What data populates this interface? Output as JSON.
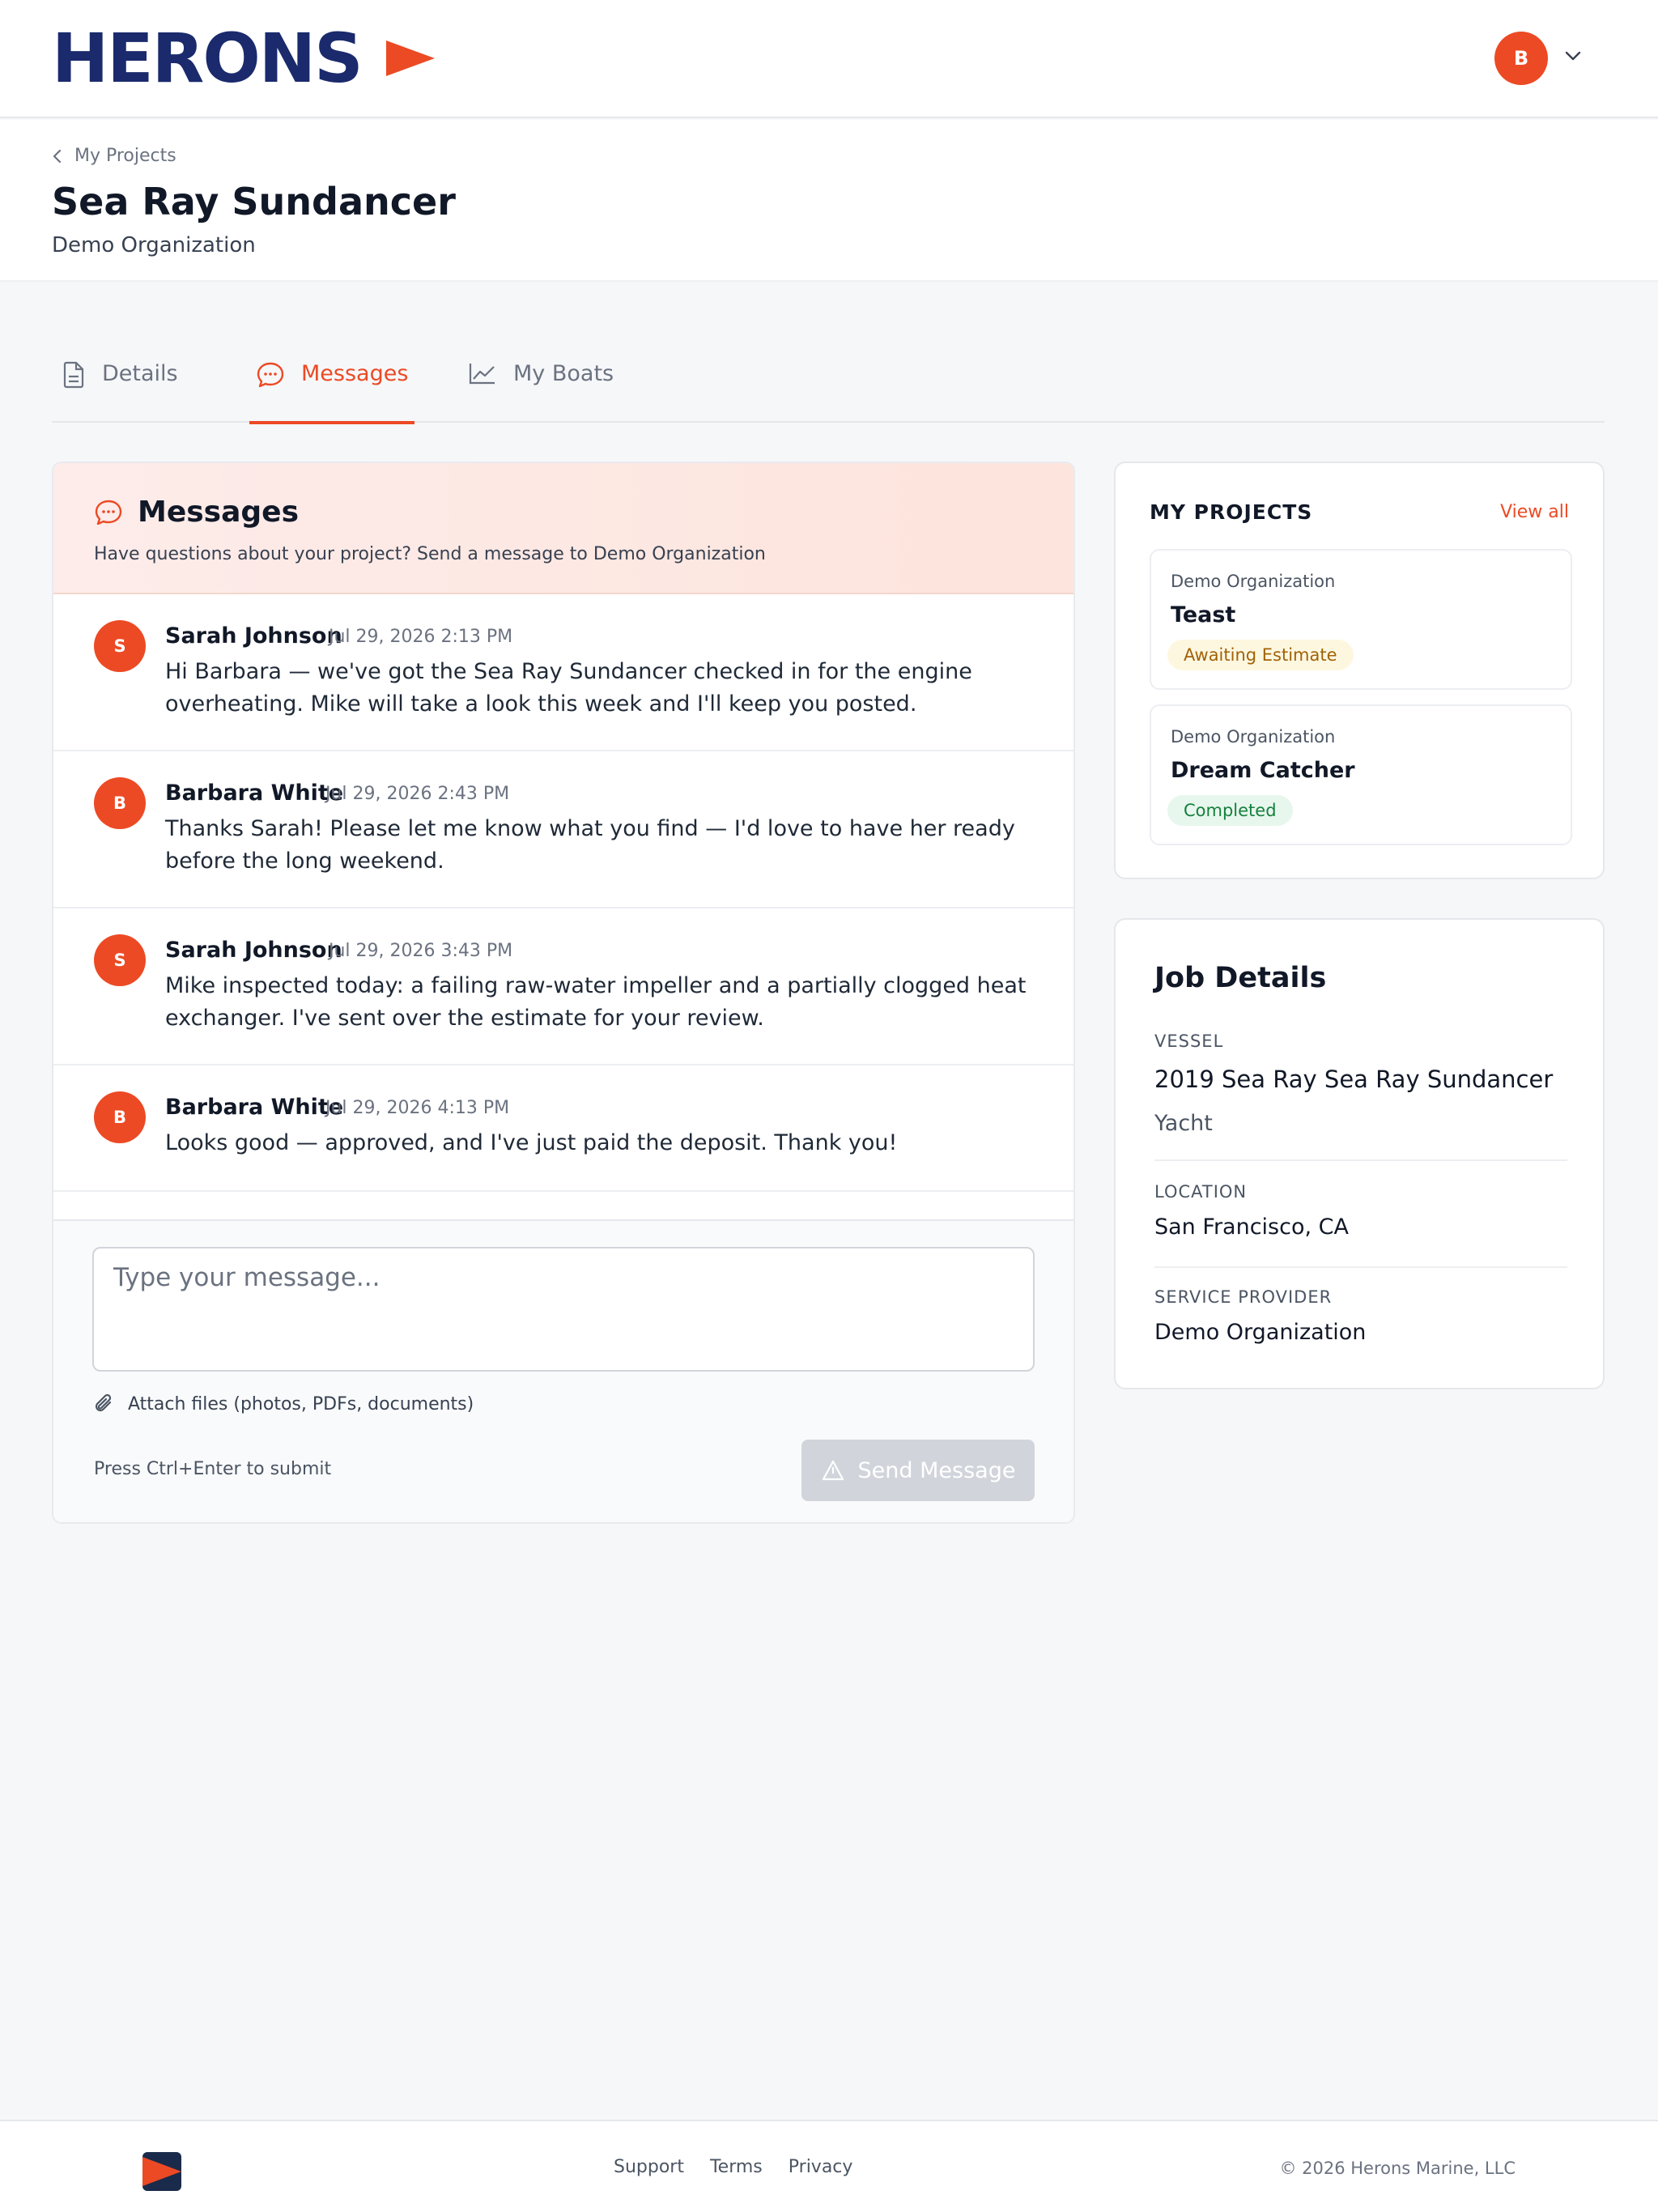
{
  "header": {
    "logo_text": "HERONS",
    "user_initial": "B"
  },
  "breadcrumb": {
    "back_label": "My Projects"
  },
  "page": {
    "title": "Sea Ray Sundancer",
    "subtitle": "Demo Organization"
  },
  "tabs": [
    {
      "label": "Details",
      "icon": "document-icon",
      "active": false
    },
    {
      "label": "Messages",
      "icon": "chat-icon",
      "active": true
    },
    {
      "label": "My Boats",
      "icon": "chart-line-icon",
      "active": false
    }
  ],
  "messages_panel": {
    "title": "Messages",
    "subtitle": "Have questions about your project? Send a message to Demo Organization",
    "items": [
      {
        "initial": "S",
        "author": "Sarah Johnson",
        "time": "Jul 29, 2026 2:13 PM",
        "body": "Hi Barbara — we've got the Sea Ray Sundancer checked in for the engine overheating. Mike will take a look this week and I'll keep you posted."
      },
      {
        "initial": "B",
        "author": "Barbara White",
        "time": "Jul 29, 2026 2:43 PM",
        "body": "Thanks Sarah! Please let me know what you find — I'd love to have her ready before the long weekend."
      },
      {
        "initial": "S",
        "author": "Sarah Johnson",
        "time": "Jul 29, 2026 3:43 PM",
        "body": "Mike inspected today: a failing raw-water impeller and a partially clogged heat exchanger. I've sent over the estimate for your review."
      },
      {
        "initial": "B",
        "author": "Barbara White",
        "time": "Jul 29, 2026 4:13 PM",
        "body": "Looks good — approved, and I've just paid the deposit. Thank you!"
      }
    ],
    "composer": {
      "placeholder": "Type your message...",
      "value": "",
      "attach_label": "Attach files (photos, PDFs, documents)",
      "hint": "Press Ctrl+Enter to submit",
      "send_label": "Send Message"
    }
  },
  "my_projects": {
    "title": "MY PROJECTS",
    "view_all": "View all",
    "items": [
      {
        "org": "Demo Organization",
        "name": "Teast",
        "status": "Awaiting Estimate",
        "status_color": "#a16207"
      },
      {
        "org": "Demo Organization",
        "name": "Dream Catcher",
        "status": "Completed",
        "status_color": "#15803d"
      }
    ]
  },
  "job_details": {
    "title": "Job Details",
    "vessel_label": "VESSEL",
    "vessel_value": "2019 Sea Ray Sea Ray Sundancer",
    "vessel_type": "Yacht",
    "location_label": "LOCATION",
    "location_value": "San Francisco, CA",
    "provider_label": "SERVICE PROVIDER",
    "provider_value": "Demo Organization"
  },
  "footer": {
    "links": [
      "Support",
      "Terms",
      "Privacy"
    ],
    "copyright": "© 2026 Herons Marine, LLC"
  },
  "colors": {
    "accent": "#ec4a24",
    "brand_navy": "#1a2a6c"
  }
}
